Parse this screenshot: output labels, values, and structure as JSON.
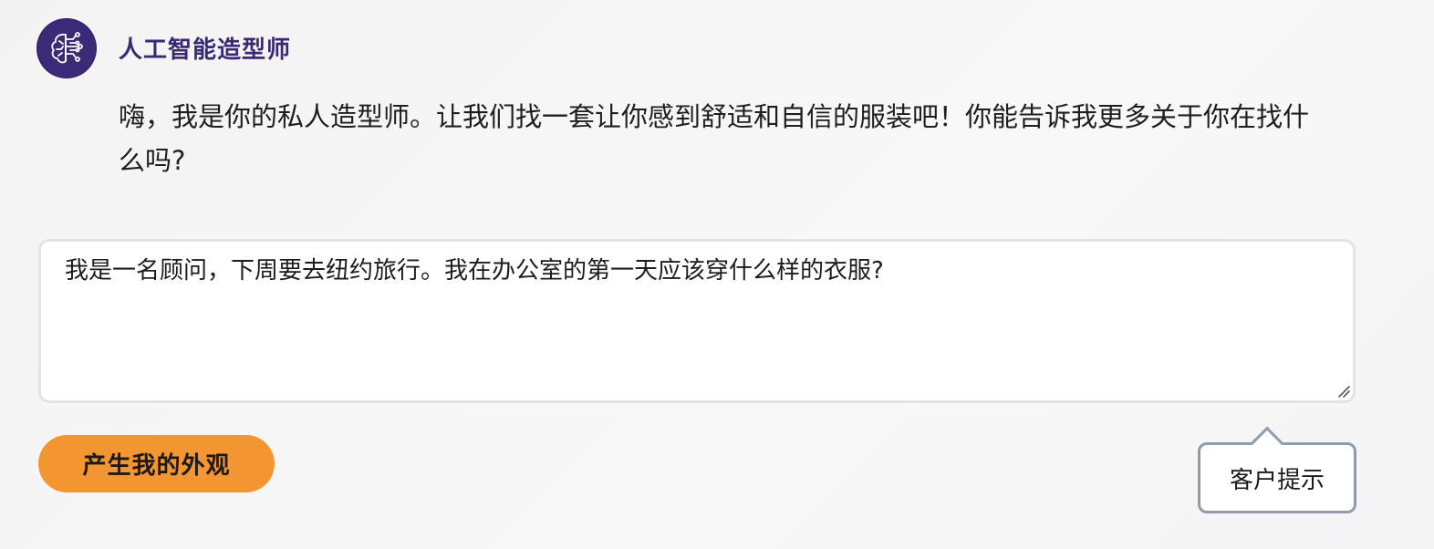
{
  "assistant": {
    "name": "人工智能造型师",
    "avatar_icon": "ai-brain-circuit-icon",
    "avatar_color": "#3a2a78",
    "message": "嗨，我是你的私人造型师。让我们找一套让你感到舒适和自信的服装吧！你能告诉我更多关于你在找什么吗?"
  },
  "prompt": {
    "value": "我是一名顾问，下周要去纽约旅行。我在办公室的第一天应该穿什么样的衣服?"
  },
  "actions": {
    "generate_label": "产生我的外观",
    "generate_color": "#f39632"
  },
  "tip": {
    "label": "客户提示"
  }
}
